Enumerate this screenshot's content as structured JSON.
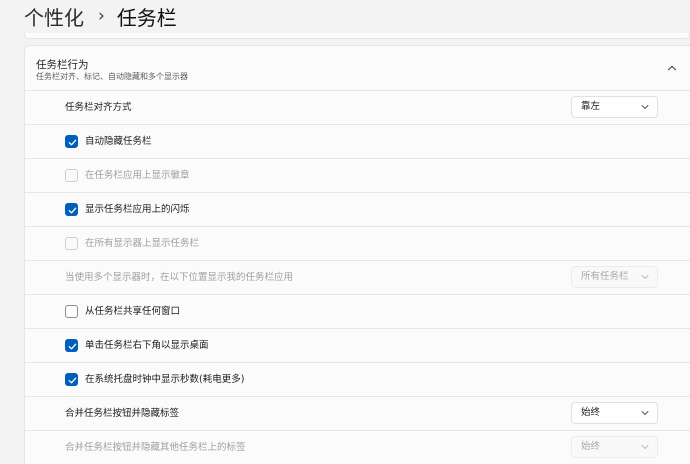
{
  "breadcrumb": {
    "parent": "个性化",
    "separator": "›",
    "current": "任务栏"
  },
  "section": {
    "title": "任务栏行为",
    "subtitle": "任务栏对齐、标记、自动隐藏和多个显示器",
    "expanded": true,
    "chevron_icon": "chevron-up-icon"
  },
  "settings": {
    "alignment": {
      "label": "任务栏对齐方式",
      "value": "靠左",
      "enabled": true
    },
    "auto_hide": {
      "label": "自动隐藏任务栏",
      "checked": true,
      "enabled": true
    },
    "badges": {
      "label": "在任务栏应用上显示徽章",
      "checked": false,
      "enabled": false
    },
    "flashing": {
      "label": "显示任务栏应用上的闪烁",
      "checked": true,
      "enabled": true
    },
    "all_displays": {
      "label": "在所有显示器上显示任务栏",
      "checked": false,
      "enabled": false
    },
    "multi_display": {
      "label": "当使用多个显示器时，在以下位置显示我的任务栏应用",
      "value": "所有任务栏",
      "enabled": false
    },
    "share_window": {
      "label": "从任务栏共享任何窗口",
      "checked": false,
      "enabled": true
    },
    "show_desktop": {
      "label": "单击任务栏右下角以显示桌面",
      "checked": true,
      "enabled": true
    },
    "show_seconds": {
      "label": "在系统托盘时钟中显示秒数(耗电更多)",
      "checked": true,
      "enabled": true
    },
    "combine_buttons": {
      "label": "合并任务栏按钮并隐藏标签",
      "value": "始终",
      "enabled": true
    },
    "combine_other": {
      "label": "合并任务栏按钮并隐藏其他任务栏上的标签",
      "value": "始终",
      "enabled": false
    }
  },
  "colors": {
    "accent": "#005fb8",
    "background": "#f3f3f3",
    "card": "#fbfbfb",
    "disabled_text": "#9f9f9f"
  }
}
